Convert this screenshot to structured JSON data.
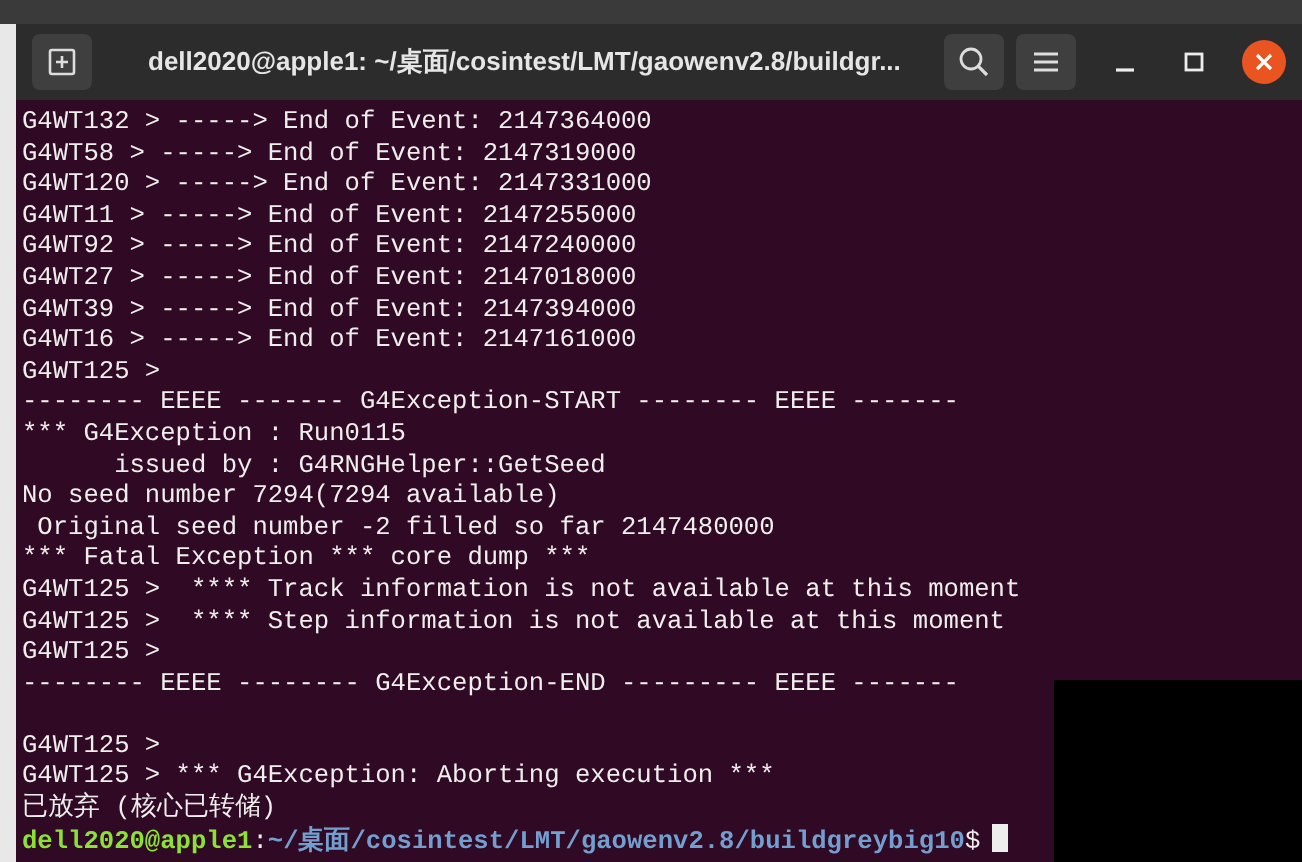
{
  "window": {
    "title": "dell2020@apple1: ~/桌面/cosintest/LMT/gaowenv2.8/buildgr..."
  },
  "terminal": {
    "lines": [
      {
        "kind": "output",
        "text": "G4WT132 > -----> End of Event: 2147364000"
      },
      {
        "kind": "output",
        "text": "G4WT58 > -----> End of Event: 2147319000"
      },
      {
        "kind": "output",
        "text": "G4WT120 > -----> End of Event: 2147331000"
      },
      {
        "kind": "output",
        "text": "G4WT11 > -----> End of Event: 2147255000"
      },
      {
        "kind": "output",
        "text": "G4WT92 > -----> End of Event: 2147240000"
      },
      {
        "kind": "output",
        "text": "G4WT27 > -----> End of Event: 2147018000"
      },
      {
        "kind": "output",
        "text": "G4WT39 > -----> End of Event: 2147394000"
      },
      {
        "kind": "output",
        "text": "G4WT16 > -----> End of Event: 2147161000"
      },
      {
        "kind": "output",
        "text": "G4WT125 >"
      },
      {
        "kind": "output",
        "text": "-------- EEEE ------- G4Exception-START -------- EEEE -------"
      },
      {
        "kind": "output",
        "text": "*** G4Exception : Run0115"
      },
      {
        "kind": "output",
        "text": "      issued by : G4RNGHelper::GetSeed"
      },
      {
        "kind": "output",
        "text": "No seed number 7294(7294 available)"
      },
      {
        "kind": "output",
        "text": " Original seed number -2 filled so far 2147480000"
      },
      {
        "kind": "output",
        "text": "*** Fatal Exception *** core dump ***"
      },
      {
        "kind": "output",
        "text": "G4WT125 >  **** Track information is not available at this moment"
      },
      {
        "kind": "output",
        "text": "G4WT125 >  **** Step information is not available at this moment"
      },
      {
        "kind": "output",
        "text": "G4WT125 >"
      },
      {
        "kind": "output",
        "text": "-------- EEEE -------- G4Exception-END --------- EEEE -------"
      },
      {
        "kind": "blank"
      },
      {
        "kind": "output",
        "text": "G4WT125 >"
      },
      {
        "kind": "output",
        "text": "G4WT125 > *** G4Exception: Aborting execution ***"
      },
      {
        "kind": "output",
        "text": "已放弃 (核心已转储)"
      }
    ],
    "prompt": {
      "user_host": "dell2020@apple1",
      "separator": ":",
      "path": "~/桌面/cosintest/LMT/gaowenv2.8/buildgreybig10",
      "symbol": "$"
    }
  }
}
